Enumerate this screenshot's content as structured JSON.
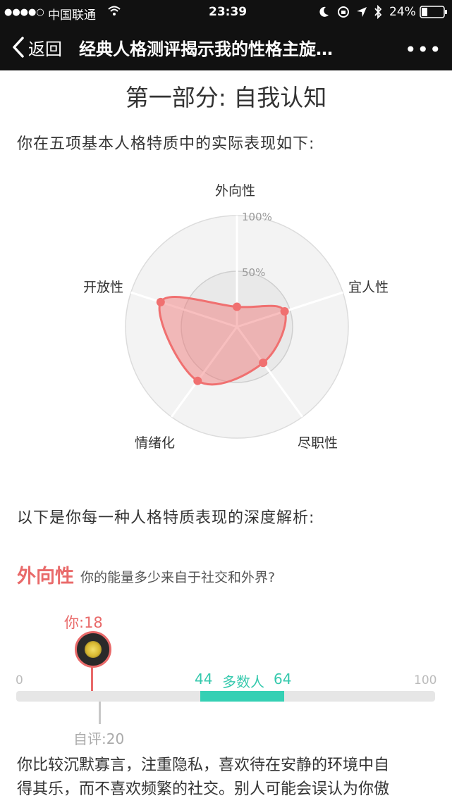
{
  "status_bar": {
    "signal": "●●●●○",
    "carrier": "中国联通",
    "time": "23:39",
    "battery_percent": "24%"
  },
  "nav": {
    "back_label": "返回",
    "title": "经典人格测评揭示我的性格主旋…",
    "more_label": "•••"
  },
  "section_title": "第一部分: 自我认知",
  "intro_text": "你在五项基本人格特质中的实际表现如下:",
  "radar": {
    "axes": [
      "外向性",
      "宜人性",
      "尽职性",
      "情绪化",
      "开放性"
    ],
    "ring_labels": [
      "100%",
      "50%"
    ],
    "values_percent": [
      18,
      45,
      40,
      60,
      72
    ],
    "color": "#f07070"
  },
  "analysis_intro": "以下是你每一种人格特质表现的深度解析:",
  "trait": {
    "name": "外向性",
    "question": "你的能量多少来自于社交和外界?",
    "you_label": "你:18",
    "you_value": 18,
    "self_label": "自评:20",
    "self_value": 20,
    "axis_min": "0",
    "axis_max": "100",
    "majority_low": "44",
    "majority_high": "64",
    "majority_label": "多数人",
    "description_lines": [
      "你比较沉默寡言，注重隐私，喜欢待在安静的环境中自",
      "得其乐，而不喜欢频繁的社交。别人可能会误认为你傲"
    ]
  },
  "colors": {
    "accent": "#e96a6a",
    "majority": "#35d0b4",
    "track": "#e6e6e6"
  }
}
